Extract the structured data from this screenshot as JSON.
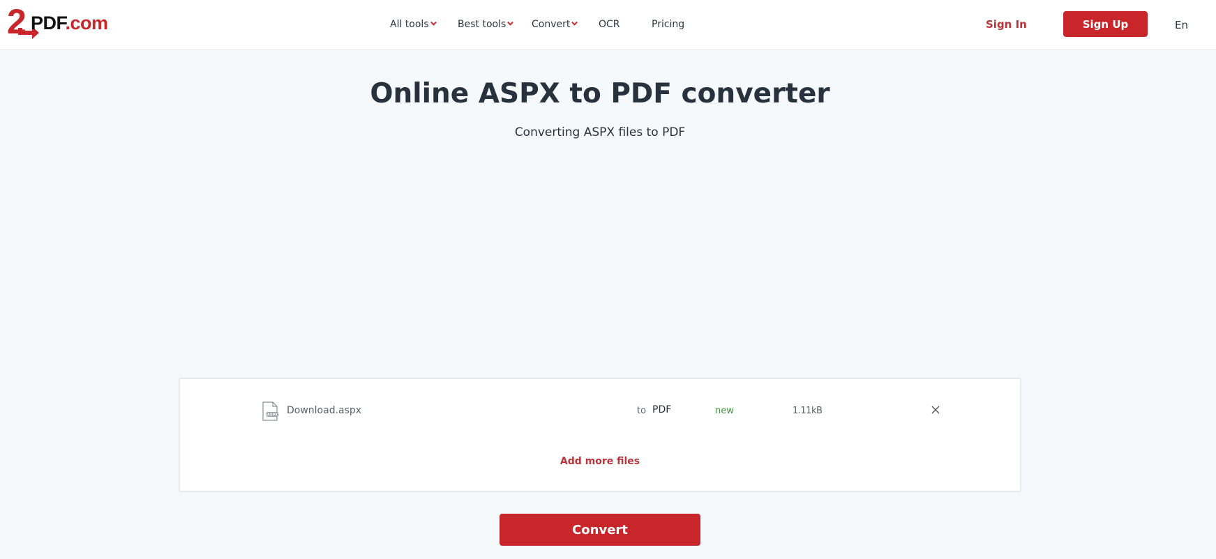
{
  "header": {
    "logo": {
      "two": "2",
      "pdf": "PDF",
      "com": ".com"
    },
    "nav": [
      {
        "label": "All tools",
        "dropdown": true
      },
      {
        "label": "Best tools",
        "dropdown": true
      },
      {
        "label": "Convert",
        "dropdown": true
      },
      {
        "label": "OCR",
        "dropdown": false
      },
      {
        "label": "Pricing",
        "dropdown": false
      }
    ],
    "sign_in": "Sign In",
    "sign_up": "Sign Up",
    "language": "En"
  },
  "main": {
    "title": "Online ASPX to PDF converter",
    "subtitle": "Converting ASPX files to PDF",
    "files": [
      {
        "icon": "aspx-file-icon",
        "icon_label": "ASPX",
        "name": "Download.aspx",
        "to_label": "to",
        "target_format": "PDF",
        "status": "new",
        "size": "1.11kB",
        "remove_icon": "close-icon"
      }
    ],
    "add_more_label": "Add more files",
    "convert_label": "Convert"
  },
  "colors": {
    "brand": "#c8262b",
    "link": "#b8343a",
    "status_new": "#3c9a3c",
    "background": "#f5f9fc",
    "text": "#27323d"
  }
}
